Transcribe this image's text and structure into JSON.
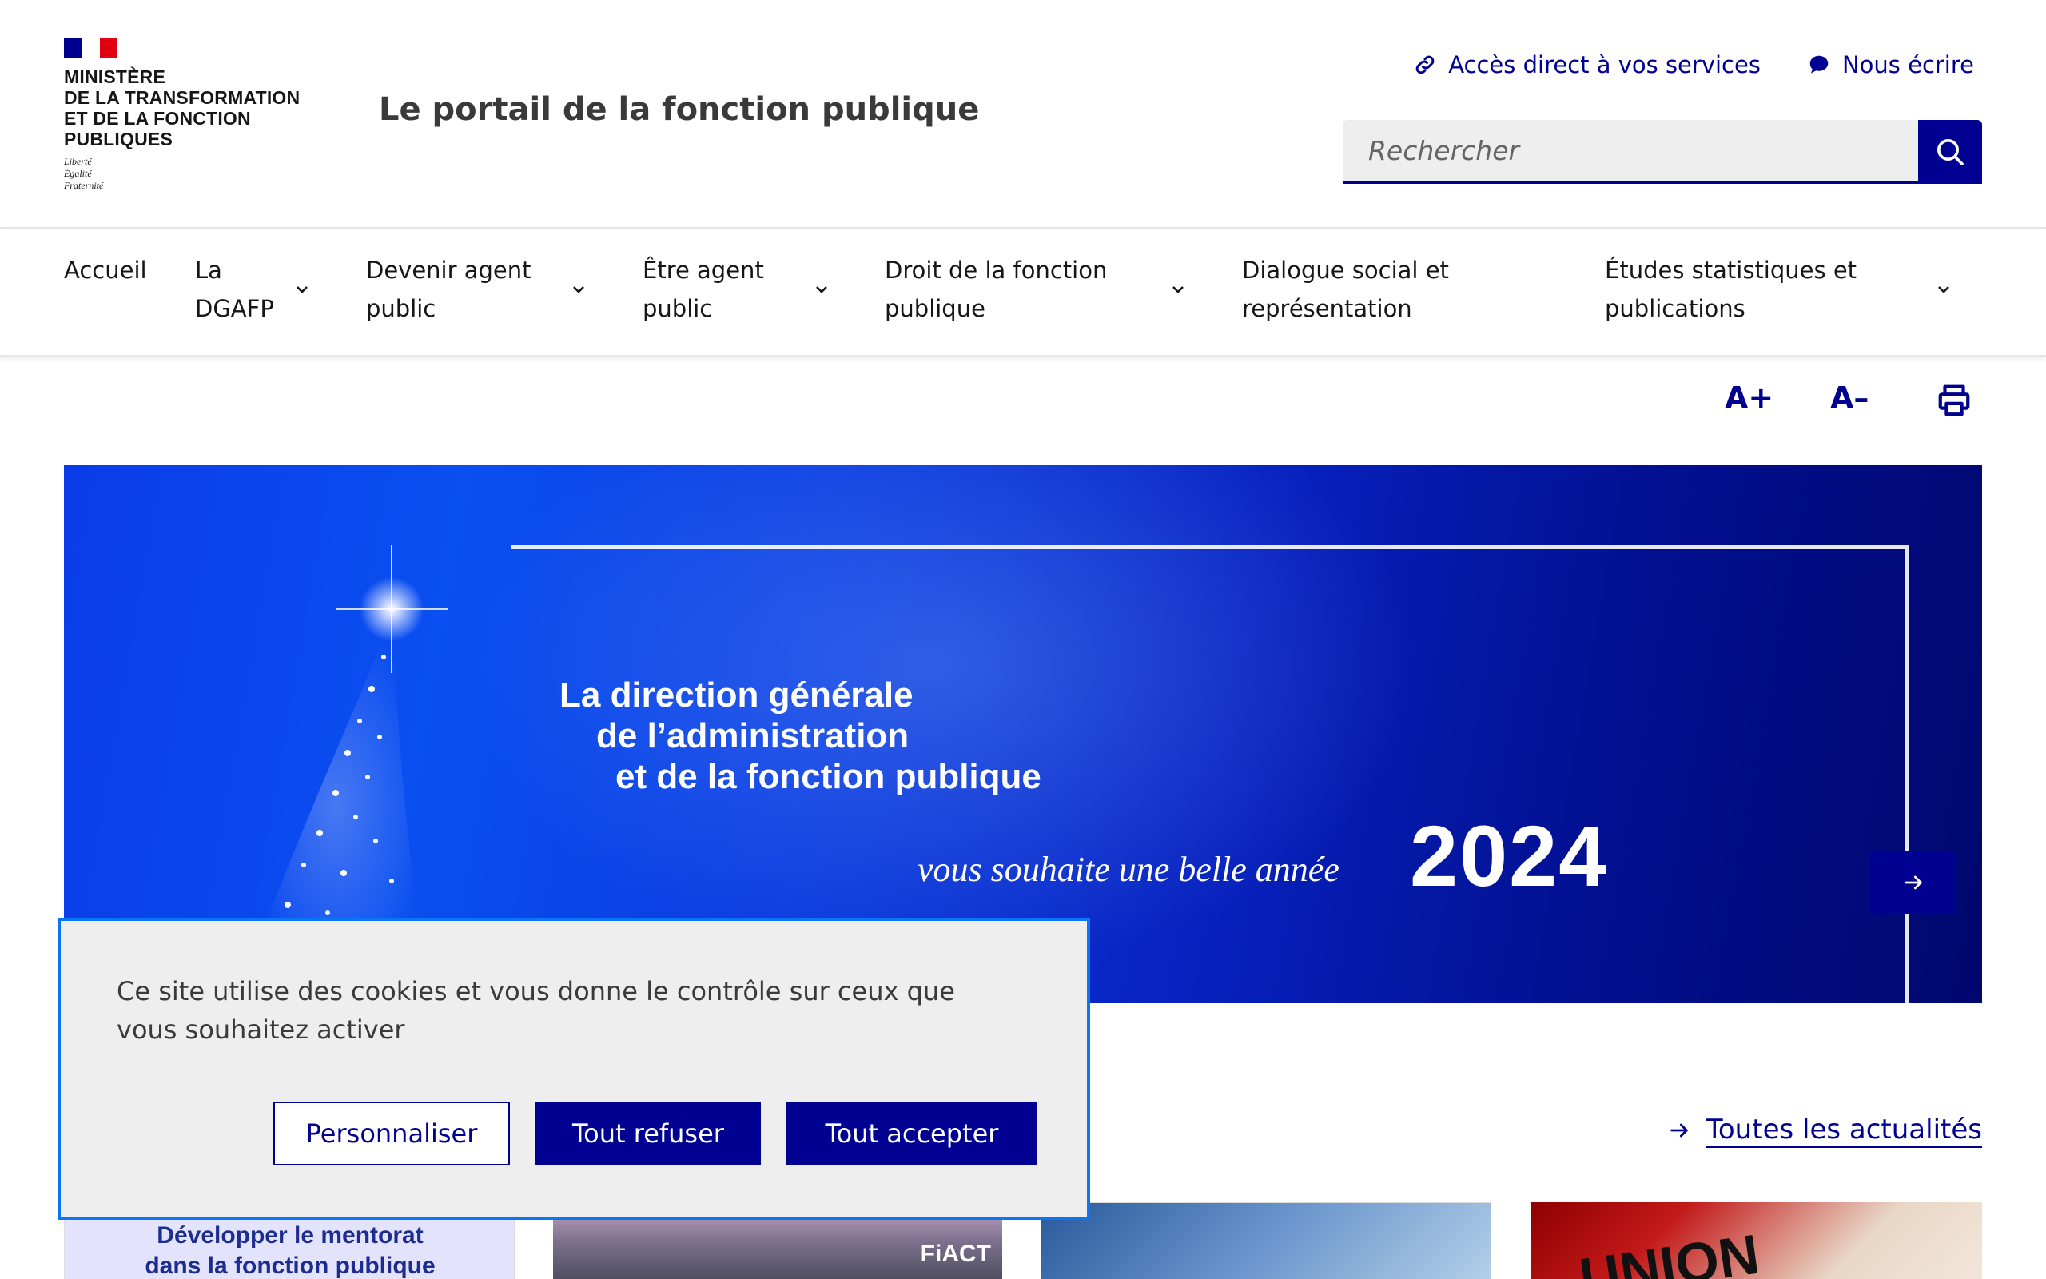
{
  "header": {
    "ministry_lines": [
      "MINISTÈRE",
      "DE LA TRANSFORMATION",
      "ET DE LA FONCTION",
      "PUBLIQUES"
    ],
    "devise_lines": [
      "Liberté",
      "Égalité",
      "Fraternité"
    ],
    "portal_title": "Le portail de la fonction publique",
    "quick_links": {
      "services": "Accès direct à vos services",
      "contact": "Nous écrire"
    },
    "search": {
      "placeholder": "Rechercher"
    }
  },
  "nav": {
    "items": [
      {
        "label_1": "Accueil",
        "label_2": ""
      },
      {
        "label_1": "La",
        "label_2": "DGAFP"
      },
      {
        "label_1": "Devenir agent",
        "label_2": "public"
      },
      {
        "label_1": "Être agent",
        "label_2": "public"
      },
      {
        "label_1": "Droit de la fonction",
        "label_2": "publique"
      },
      {
        "label_1": "Dialogue social et",
        "label_2": "représentation"
      },
      {
        "label_1": "Études statistiques et",
        "label_2": "publications"
      }
    ]
  },
  "tools": {
    "increase": "A+",
    "decrease": "A–"
  },
  "banner": {
    "line1": "La direction générale",
    "line2": "de l’administration",
    "line3": "et de la fonction publique",
    "wish": "vous souhaite une belle année",
    "year": "2024"
  },
  "news": {
    "all_link": "Toutes les actualités",
    "card1_line1": "Développer le  mentorat",
    "card1_line2": "dans la fonction publique",
    "card2_logo": "FiACT",
    "card4_text": "UNION"
  },
  "cookie": {
    "text": "Ce site utilise des cookies et vous donne le contrôle sur ceux que vous souhaitez activer",
    "customize": "Personnaliser",
    "refuse": "Tout refuser",
    "accept": "Tout accepter"
  },
  "colors": {
    "primary": "#000091",
    "focus": "#0a76f6",
    "marianne_red": "#e1000f"
  }
}
